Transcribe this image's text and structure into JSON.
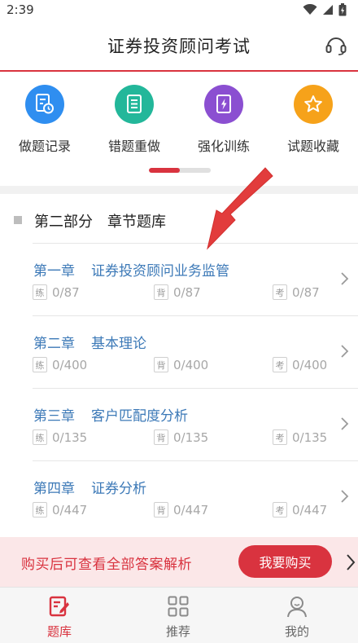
{
  "status_bar": {
    "time": "2:39"
  },
  "header": {
    "title": "证券投资顾问考试"
  },
  "quick_actions": [
    {
      "label": "做题记录",
      "icon": "record-clock-icon",
      "color": "#2f8ef0"
    },
    {
      "label": "错题重做",
      "icon": "list-book-icon",
      "color": "#23b79a"
    },
    {
      "label": "强化训练",
      "icon": "lightning-book-icon",
      "color": "#8b4fd1"
    },
    {
      "label": "试题收藏",
      "icon": "star-icon",
      "color": "#f6a21a"
    }
  ],
  "pager": {
    "active_fraction": 0.5
  },
  "section": {
    "part": "第二部分",
    "name": "章节题库"
  },
  "chapters": [
    {
      "number": "第一章",
      "name": "证券投资顾问业务监管",
      "practice_tag": "练",
      "practice": "0/87",
      "recite_tag": "背",
      "recite": "0/87",
      "exam_tag": "考",
      "exam": "0/87"
    },
    {
      "number": "第二章",
      "name": "基本理论",
      "practice_tag": "练",
      "practice": "0/400",
      "recite_tag": "背",
      "recite": "0/400",
      "exam_tag": "考",
      "exam": "0/400"
    },
    {
      "number": "第三章",
      "name": "客户匹配度分析",
      "practice_tag": "练",
      "practice": "0/135",
      "recite_tag": "背",
      "recite": "0/135",
      "exam_tag": "考",
      "exam": "0/135"
    },
    {
      "number": "第四章",
      "name": "证券分析",
      "practice_tag": "练",
      "practice": "0/447",
      "recite_tag": "背",
      "recite": "0/447",
      "exam_tag": "考",
      "exam": "0/447"
    }
  ],
  "promo": {
    "text": "购买后可查看全部答案解析",
    "button": "我要购买"
  },
  "tabs": [
    {
      "label": "题库",
      "icon": "question-bank-icon",
      "active": true
    },
    {
      "label": "推荐",
      "icon": "grid-icon",
      "active": false
    },
    {
      "label": "我的",
      "icon": "profile-icon",
      "active": false
    }
  ],
  "colors": {
    "accent": "#d9333f",
    "chapter_text": "#3c79b7",
    "promo_bg": "#fbe7e8"
  }
}
